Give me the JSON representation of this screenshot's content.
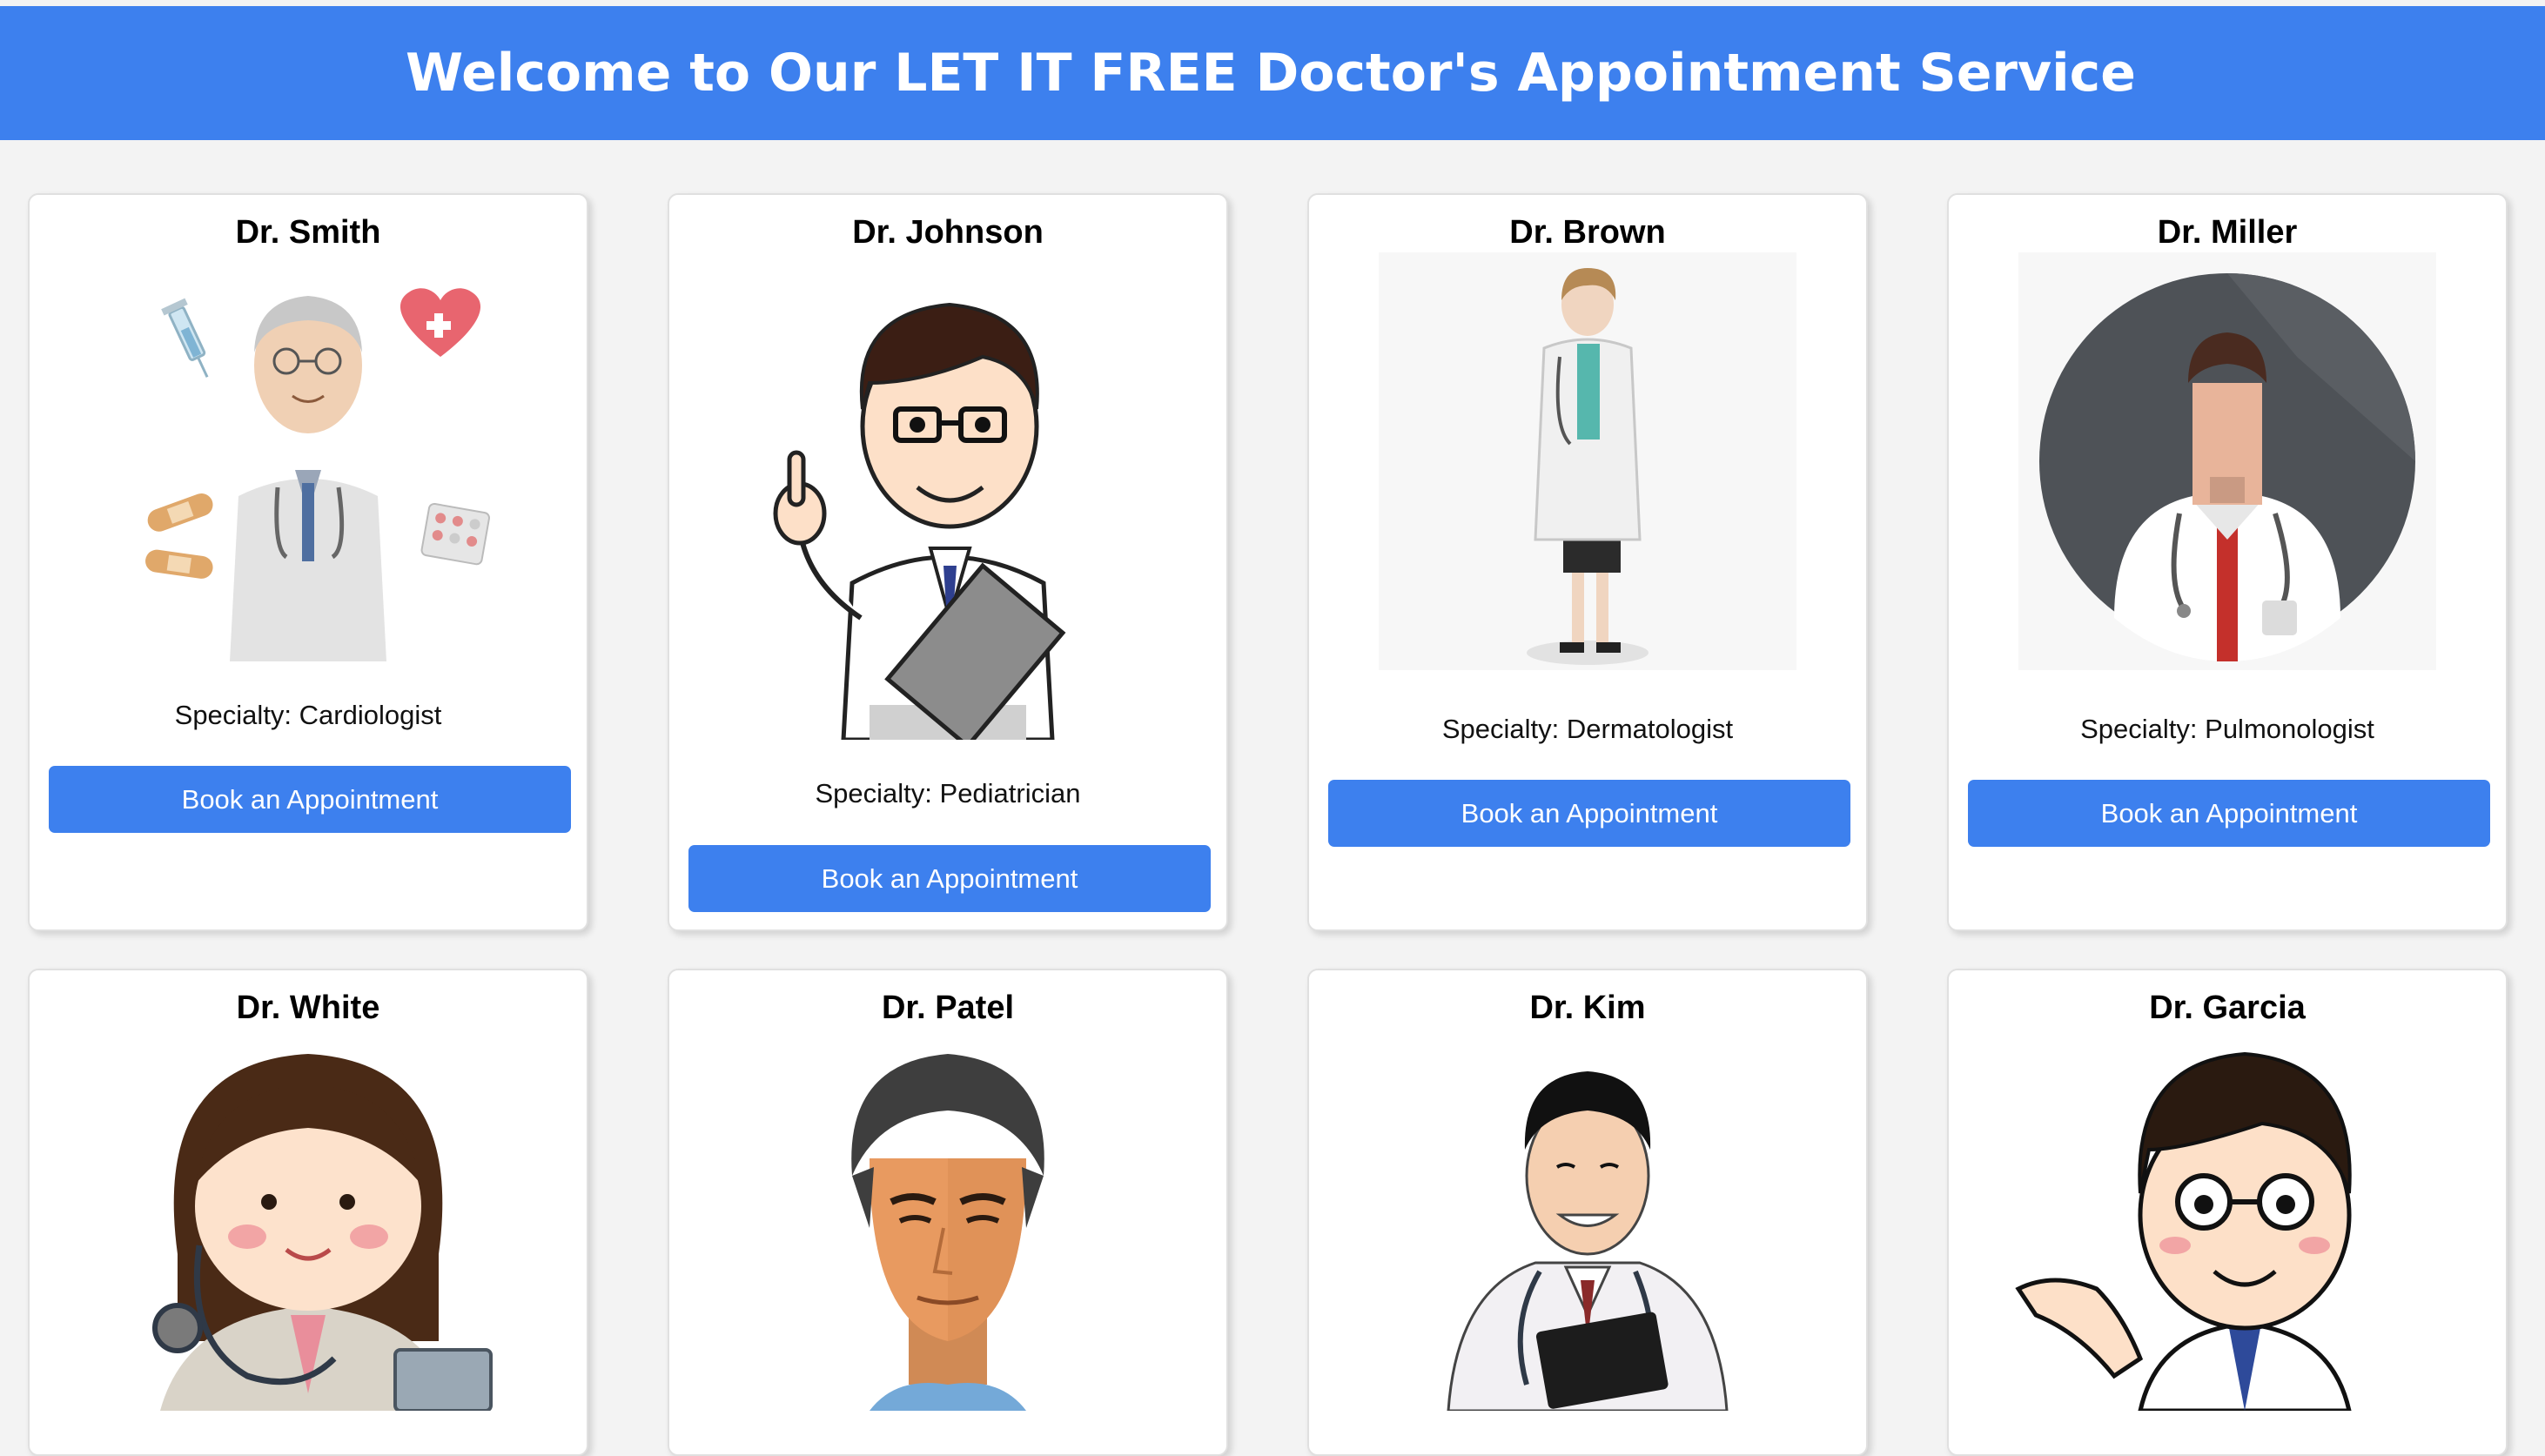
{
  "header": {
    "title": "Welcome to Our LET IT FREE Doctor's Appointment Service"
  },
  "doctors": [
    {
      "name": "Dr. Smith",
      "specialty": "Specialty: Cardiologist",
      "button": "Book an Appointment",
      "icon": "doctor-smith-illustration"
    },
    {
      "name": "Dr. Johnson",
      "specialty": "Specialty: Pediatrician",
      "button": "Book an Appointment",
      "icon": "doctor-johnson-illustration"
    },
    {
      "name": "Dr. Brown",
      "specialty": "Specialty: Dermatologist",
      "button": "Book an Appointment",
      "icon": "doctor-brown-illustration"
    },
    {
      "name": "Dr. Miller",
      "specialty": "Specialty: Pulmonologist",
      "button": "Book an Appointment",
      "icon": "doctor-miller-illustration"
    },
    {
      "name": "Dr. White",
      "icon": "doctor-white-illustration"
    },
    {
      "name": "Dr. Patel",
      "icon": "doctor-patel-illustration"
    },
    {
      "name": "Dr. Kim",
      "icon": "doctor-kim-illustration"
    },
    {
      "name": "Dr. Garcia",
      "icon": "doctor-garcia-illustration"
    }
  ],
  "colors": {
    "accent": "#3d80ee",
    "page_background": "#f3f3f3",
    "card_background": "#ffffff"
  }
}
